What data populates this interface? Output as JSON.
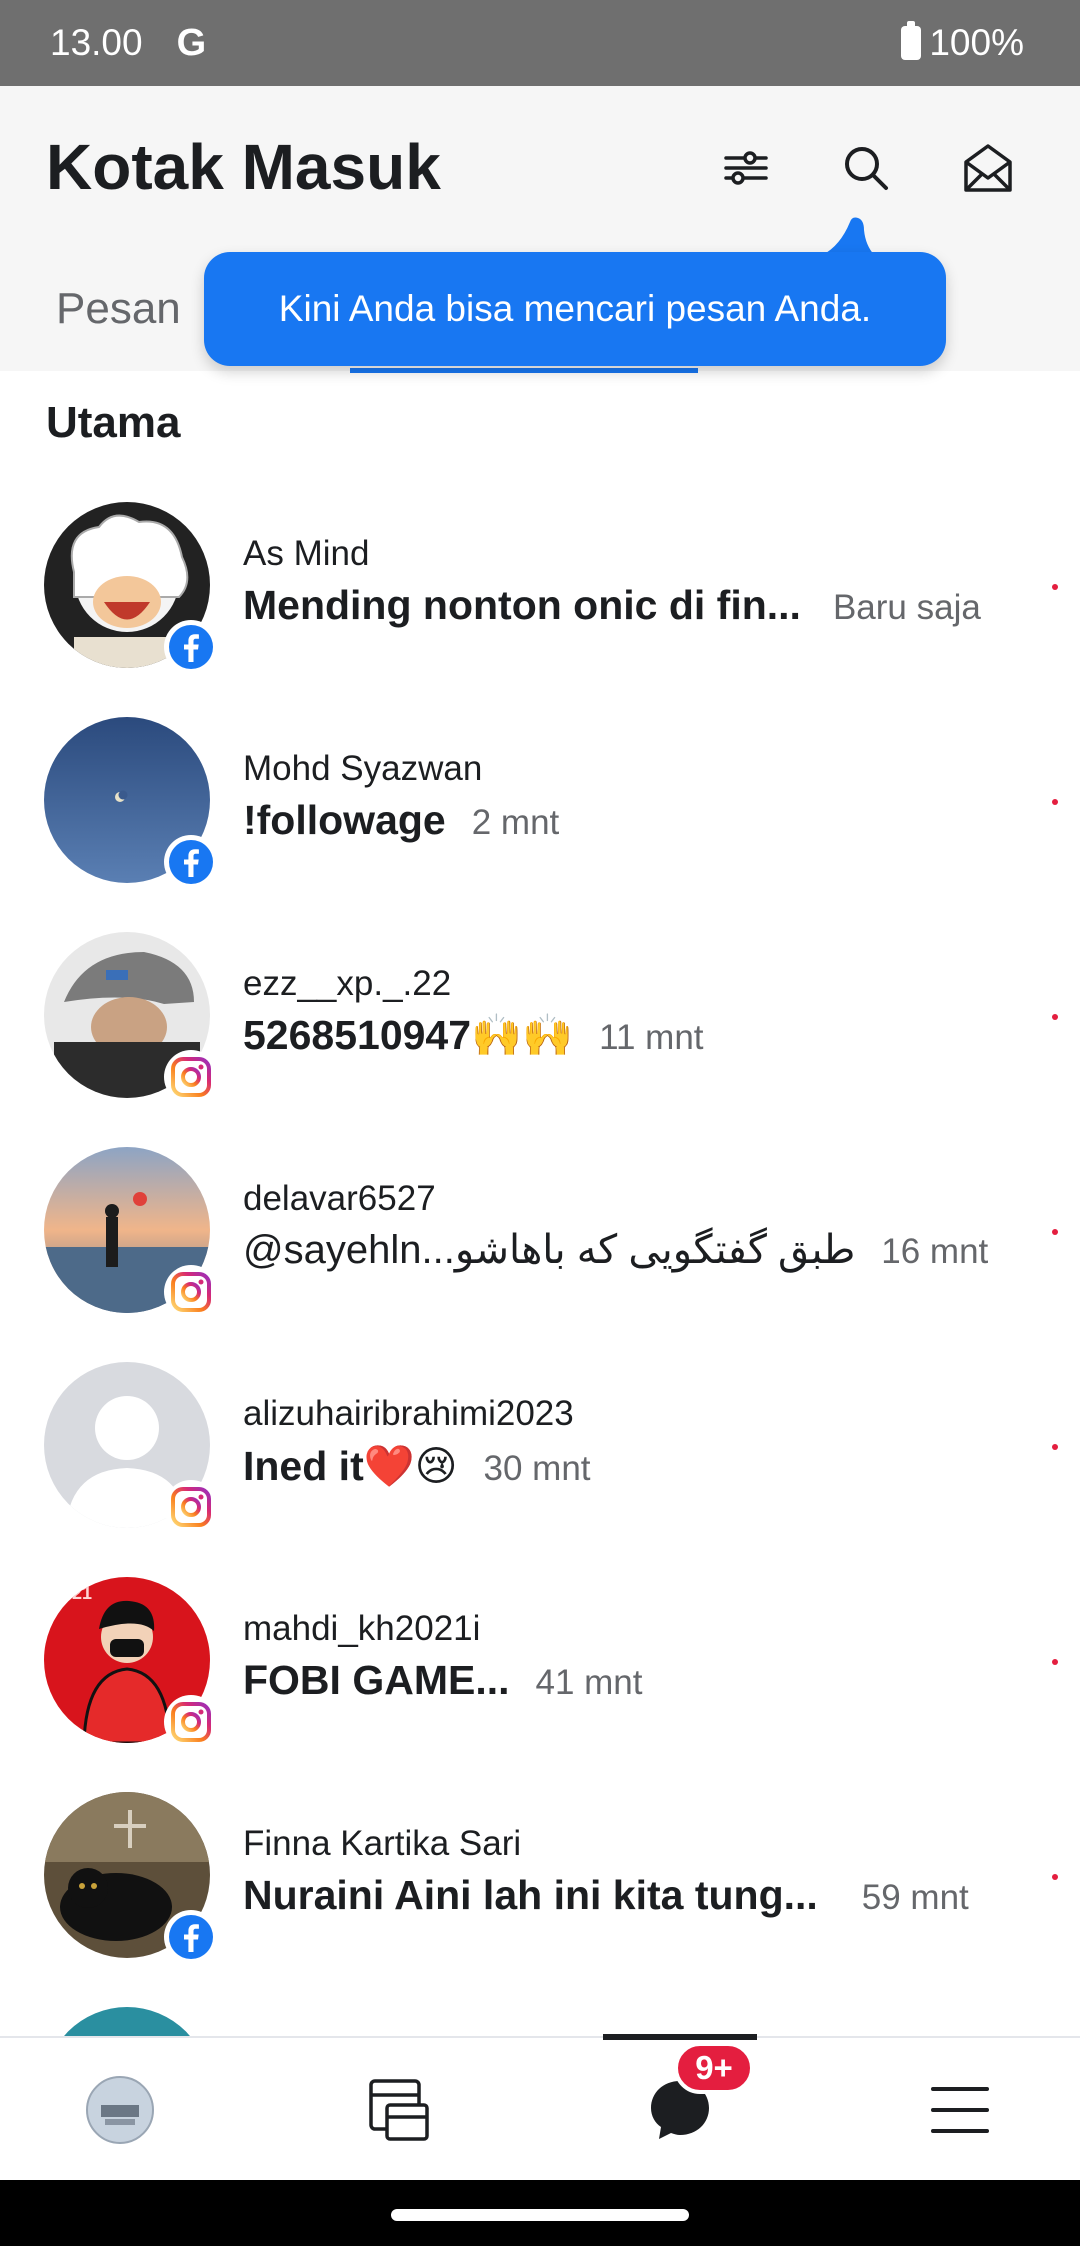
{
  "status_bar": {
    "time": "13.00",
    "carrier_icon": "G",
    "battery": "100%"
  },
  "header": {
    "title": "Kotak Masuk",
    "icons": [
      "filter-icon",
      "search-icon",
      "mail-open-icon"
    ],
    "tab_label": "Pesan"
  },
  "tooltip": {
    "text": "Kini Anda bisa mencari pesan Anda."
  },
  "section": {
    "title": "Utama"
  },
  "conversations": [
    {
      "name": "As Mind",
      "message": "Mending nonton onic di fin...",
      "time": "Baru saja",
      "platform": "facebook"
    },
    {
      "name": "Mohd Syazwan",
      "message": "!followage",
      "time": "2 mnt",
      "platform": "facebook"
    },
    {
      "name": "ezz__xp._.22",
      "message": "5268510947🙌🙌",
      "time": "11 mnt",
      "platform": "instagram"
    },
    {
      "name": "delavar6527",
      "message": "@sayehln...طبق گفتگویی که باهاشو",
      "time": "16 mnt",
      "platform": "instagram"
    },
    {
      "name": "alizuhairibrahimi2023",
      "message": "Ined it❤️😢",
      "time": "30 mnt",
      "platform": "instagram"
    },
    {
      "name": "mahdi_kh2021i",
      "message": "FOBI GAME...",
      "time": "41 mnt",
      "platform": "instagram"
    },
    {
      "name": "Finna Kartika Sari",
      "message": "Nuraini Aini lah ini kita tung...",
      "time": "59 mnt",
      "platform": "facebook"
    }
  ],
  "bottom_nav": {
    "items": [
      "profile-avatar",
      "feeds-icon",
      "chats-icon",
      "menu-icon"
    ],
    "chat_badge": "9+"
  },
  "colors": {
    "accent": "#1877f2",
    "unread": "#e41e3f",
    "statusbar": "#6f6f6f"
  }
}
